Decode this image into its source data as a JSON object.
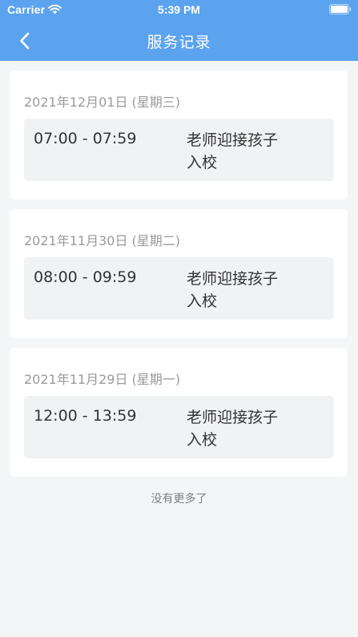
{
  "status_bar": {
    "carrier": "Carrier",
    "time": "5:39 PM"
  },
  "nav": {
    "title": "服务记录",
    "back_icon": "chevron-left-icon"
  },
  "colors": {
    "header": "#5ba3ef",
    "page_background": "#f4f5f7",
    "card": "#ffffff",
    "item_background": "#f1f2f4"
  },
  "records": [
    {
      "date": "2021年12月01日 (星期三)",
      "time": "07:00 - 07:59",
      "desc_line1": "老师迎接孩子",
      "desc_line2": "入校"
    },
    {
      "date": "2021年11月30日 (星期二)",
      "time": "08:00 - 09:59",
      "desc_line1": "老师迎接孩子",
      "desc_line2": "入校"
    },
    {
      "date": "2021年11月29日 (星期一)",
      "time": "12:00 - 13:59",
      "desc_line1": "老师迎接孩子",
      "desc_line2": "入校"
    }
  ],
  "footer": {
    "no_more_text": "没有更多了"
  }
}
